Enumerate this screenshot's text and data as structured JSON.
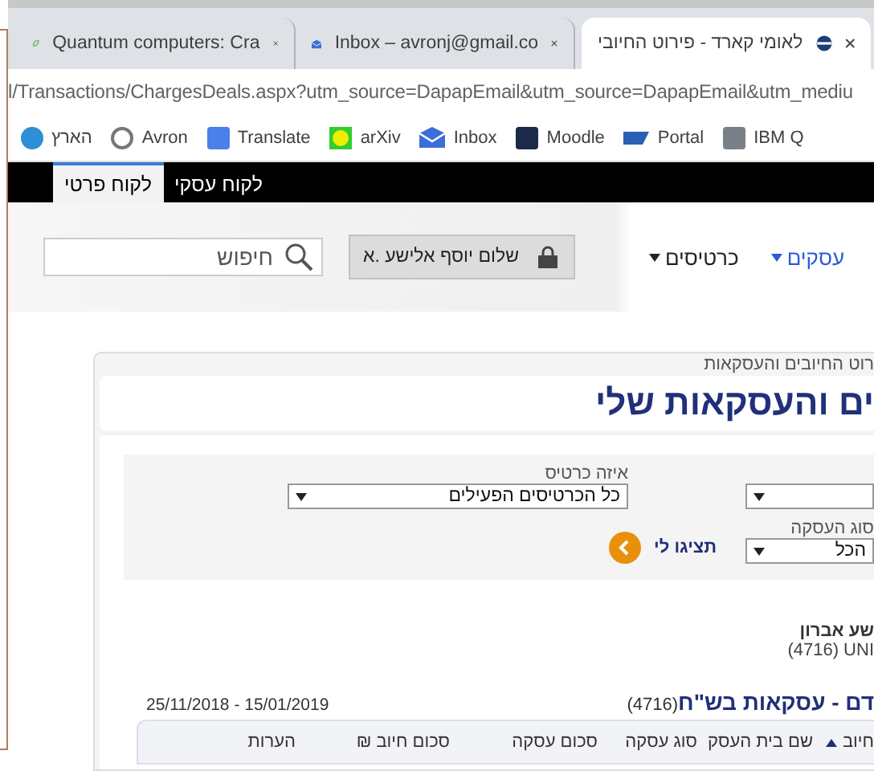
{
  "browser_tabs": [
    {
      "title": "לאומי קארד - פירוט החיובי",
      "selected": true
    },
    {
      "title": "Inbox – avronj@gmail.co",
      "selected": false
    },
    {
      "title": "Quantum computers: Cra",
      "selected": false
    }
  ],
  "address": "l/Transactions/ChargesDeals.aspx?utm_source=DapapEmail&utm_source=DapapEmail&utm_mediu",
  "bookmarks": [
    {
      "label": "IBM Q",
      "color": "#7a8088"
    },
    {
      "label": "Portal",
      "color": "#2b5fb3"
    },
    {
      "label": "Moodle",
      "color": "#1c2a4a"
    },
    {
      "label": "Inbox",
      "color": "#3a6fd8"
    },
    {
      "label": "arXiv",
      "color": "#33cc33"
    },
    {
      "label": "Translate",
      "color": "#4a80e8"
    },
    {
      "label": "Avron",
      "color": "#777777"
    },
    {
      "label": "הארץ",
      "color": "#2d8fd5"
    }
  ],
  "customer_tabs": [
    {
      "label": "לקוח עסקי",
      "selected": false
    },
    {
      "label": "לקוח פרטי",
      "selected": true
    }
  ],
  "search": {
    "placeholder": "חיפוש"
  },
  "greeting": "שלום יוסף אלישע .א",
  "nav": [
    {
      "label": "עסקים",
      "active": true
    },
    {
      "label": "כרטיסים",
      "active": false
    }
  ],
  "breadcrumb": "רוט החיובים והעסקאות",
  "page_title": "ים והעסקאות שלי",
  "filters": {
    "card_label": "איזה כרטיס",
    "card_value": "כל הכרטיסים הפעילים",
    "type_label": "סוג העסקה",
    "type_value": "הכל",
    "submit": "תציגו לי"
  },
  "owner": {
    "name": "שע אברון",
    "card": "(4716)  UNI"
  },
  "section": {
    "title": "דם - עסקאות בש\"ח",
    "card": "(4716)",
    "dates": "25/11/2018 - 15/01/2019"
  },
  "table": {
    "columns": [
      {
        "label": "חיוב",
        "sorted": true
      },
      {
        "label": "שם בית העסק",
        "sorted": false
      },
      {
        "label": "סוג עסקה",
        "sorted": false
      },
      {
        "label": "סכום עסקה",
        "sorted": false
      },
      {
        "label": "סכום חיוב ₪",
        "sorted": false
      },
      {
        "label": "הערות",
        "sorted": false
      }
    ]
  }
}
